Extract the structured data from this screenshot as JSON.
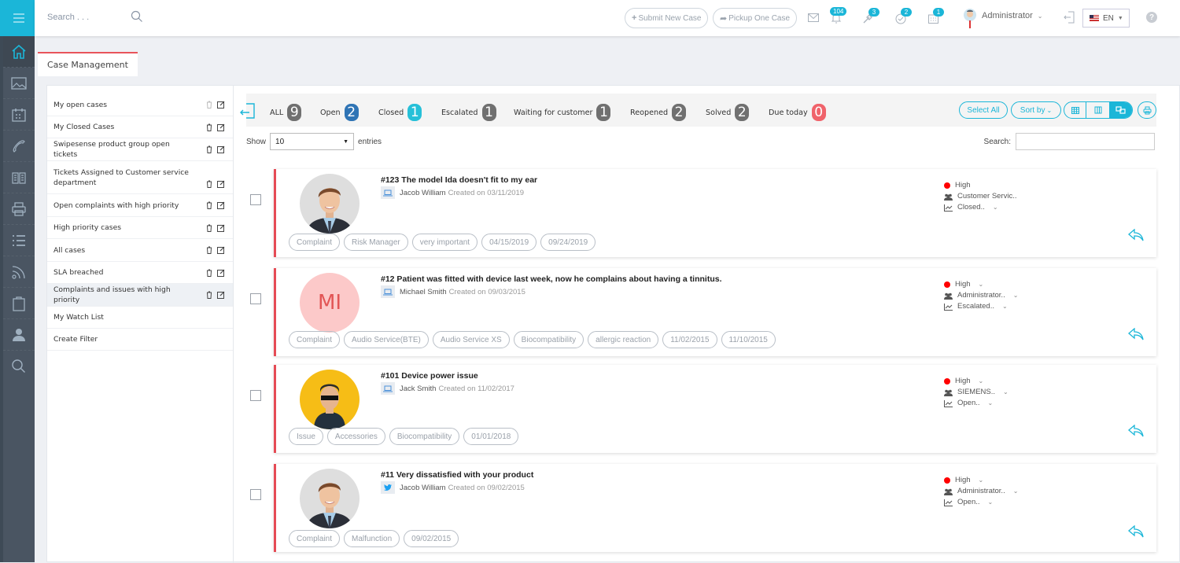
{
  "topbar": {
    "search_placeholder": "Search . . .",
    "submit_case": "Submit New Case",
    "pickup_case": "Pickup One Case",
    "badges": {
      "notifications": "104",
      "keys": "3",
      "tasks": "2",
      "calendar": "1"
    },
    "user_name": "Administrator",
    "language": "EN"
  },
  "sidebar_nav": [
    "home-icon",
    "image-icon",
    "calendar-icon",
    "phone-icon",
    "book-icon",
    "printer-icon",
    "list-icon",
    "rss-icon",
    "clipboard-icon",
    "user-icon",
    "search-icon"
  ],
  "tab": {
    "label": "Case Management"
  },
  "filters": [
    {
      "label": "My open cases",
      "actions": true
    },
    {
      "label": "My Closed Cases",
      "actions": true
    },
    {
      "label": "Swipesense product group open tickets",
      "actions": true
    },
    {
      "label": "Tickets Assigned to Customer service department",
      "actions": true
    },
    {
      "label": "Open complaints with high priority",
      "actions": true
    },
    {
      "label": "High priority cases",
      "actions": true
    },
    {
      "label": "All cases",
      "actions": true
    },
    {
      "label": "SLA breached",
      "actions": true
    },
    {
      "label": "Complaints and issues with high priority",
      "actions": true,
      "selected": true
    },
    {
      "label": "My Watch List",
      "actions": false
    },
    {
      "label": "Create Filter",
      "actions": false
    }
  ],
  "statuses": [
    {
      "label": "ALL",
      "count": "9",
      "color": "#707070"
    },
    {
      "label": "Open",
      "count": "2",
      "color": "#2f74b5"
    },
    {
      "label": "Closed",
      "count": "1",
      "color": "#26c0d8"
    },
    {
      "label": "Escalated",
      "count": "1",
      "color": "#707070"
    },
    {
      "label": "Waiting for customer",
      "count": "1",
      "color": "#707070"
    },
    {
      "label": "Reopened",
      "count": "2",
      "color": "#707070"
    },
    {
      "label": "Solved",
      "count": "2",
      "color": "#707070"
    },
    {
      "label": "Due today",
      "count": "0",
      "color": "#f0636b"
    }
  ],
  "toolbar": {
    "select_all": "Select All",
    "sort_by": "Sort by"
  },
  "table": {
    "show_label": "Show",
    "entries_value": "10",
    "entries_label": "entries",
    "search_label": "Search:",
    "search_value": ""
  },
  "cases": [
    {
      "title": "#123 The model Ida doesn't fit to my ear",
      "source": "laptop",
      "author": "Jacob William",
      "created": "Created on 03/11/2019",
      "avatar": "photo",
      "tags": [
        "Complaint",
        "Risk Manager",
        "very important",
        "04/15/2019",
        "09/24/2019"
      ],
      "priority": "High",
      "assignee": "Customer Servic..",
      "status": "Closed..",
      "priority_dropdown": false
    },
    {
      "title": "#12 Patient was fitted with device last week, now he complains about having a tinnitus.",
      "source": "laptop",
      "author": "Michael Smith",
      "created": "Created on 09/03/2015",
      "avatar": "initials",
      "initials": "MI",
      "tags": [
        "Complaint",
        "Audio Service(BTE)",
        "Audio Service XS",
        "Biocompatibility",
        "allergic reaction",
        "11/02/2015",
        "11/10/2015"
      ],
      "priority": "High",
      "assignee": "Administrator..",
      "status": "Escalated..",
      "priority_dropdown": true
    },
    {
      "title": "#101 Device power issue",
      "source": "laptop",
      "author": "Jack Smith",
      "created": "Created on 11/02/2017",
      "avatar": "cartoon",
      "tags": [
        "Issue",
        "Accessories",
        "Biocompatibility",
        "01/01/2018"
      ],
      "priority": "High",
      "assignee": "SIEMENS..",
      "status": "Open..",
      "priority_dropdown": true
    },
    {
      "title": "#11 Very dissatisfied with your product",
      "source": "twitter",
      "author": "Jacob William",
      "created": "Created on 09/02/2015",
      "avatar": "photo",
      "tags": [
        "Complaint",
        "Malfunction",
        "09/02/2015"
      ],
      "priority": "High",
      "assignee": "Administrator..",
      "status": "Open..",
      "priority_dropdown": true
    }
  ],
  "colors": {
    "accent": "#1bb6d8",
    "danger": "#e54b55",
    "sidebar": "#4a5562"
  }
}
